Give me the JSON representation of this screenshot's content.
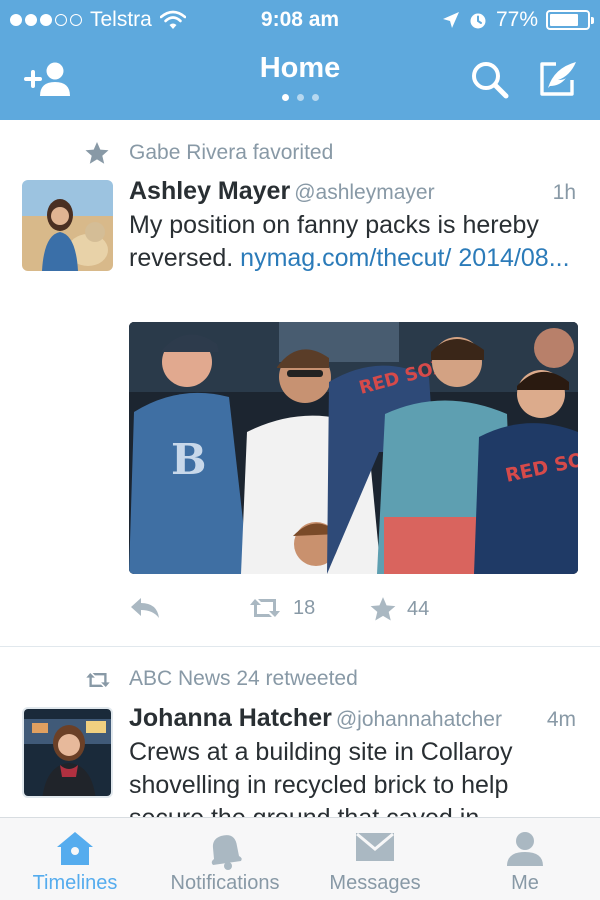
{
  "status_bar": {
    "carrier": "Telstra",
    "time": "9:08 am",
    "battery": "77%",
    "battery_level": 0.77,
    "signal_bars_filled": 3,
    "signal_bars_total": 5
  },
  "nav": {
    "title": "Home",
    "page_count": 3,
    "current_page": 1,
    "left_icon": "add-user-icon",
    "right_icons": [
      "search-icon",
      "compose-icon"
    ]
  },
  "tweets": [
    {
      "context_icon": "star-icon",
      "context": "Gabe Rivera favorited",
      "name": "Ashley Mayer",
      "handle": "@ashleymayer",
      "time": "1h",
      "text": "My position on fanny packs is hereby reversed.",
      "link": "nymag.com/thecut/ 2014/08...",
      "has_media": true,
      "actions": {
        "reply_icon": "reply-icon",
        "retweets": "18",
        "favorites": "44"
      }
    },
    {
      "context_icon": "retweet-icon",
      "context": "ABC News 24 retweeted",
      "name": "Johanna Hatcher",
      "handle": "@johannahatcher",
      "time": "4m",
      "text": "Crews at a building site in Collaroy shovelling in recycled brick to help secure the ground that caved in"
    }
  ],
  "tabs": [
    {
      "label": "Timelines",
      "icon": "home-icon",
      "active": true
    },
    {
      "label": "Notifications",
      "icon": "bell-icon",
      "active": false
    },
    {
      "label": "Messages",
      "icon": "envelope-icon",
      "active": false
    },
    {
      "label": "Me",
      "icon": "person-icon",
      "active": false
    }
  ],
  "colors": {
    "brand": "#5ea9dd",
    "accent": "#55acee",
    "link": "#2b7bb9",
    "muted": "#8899a6"
  }
}
